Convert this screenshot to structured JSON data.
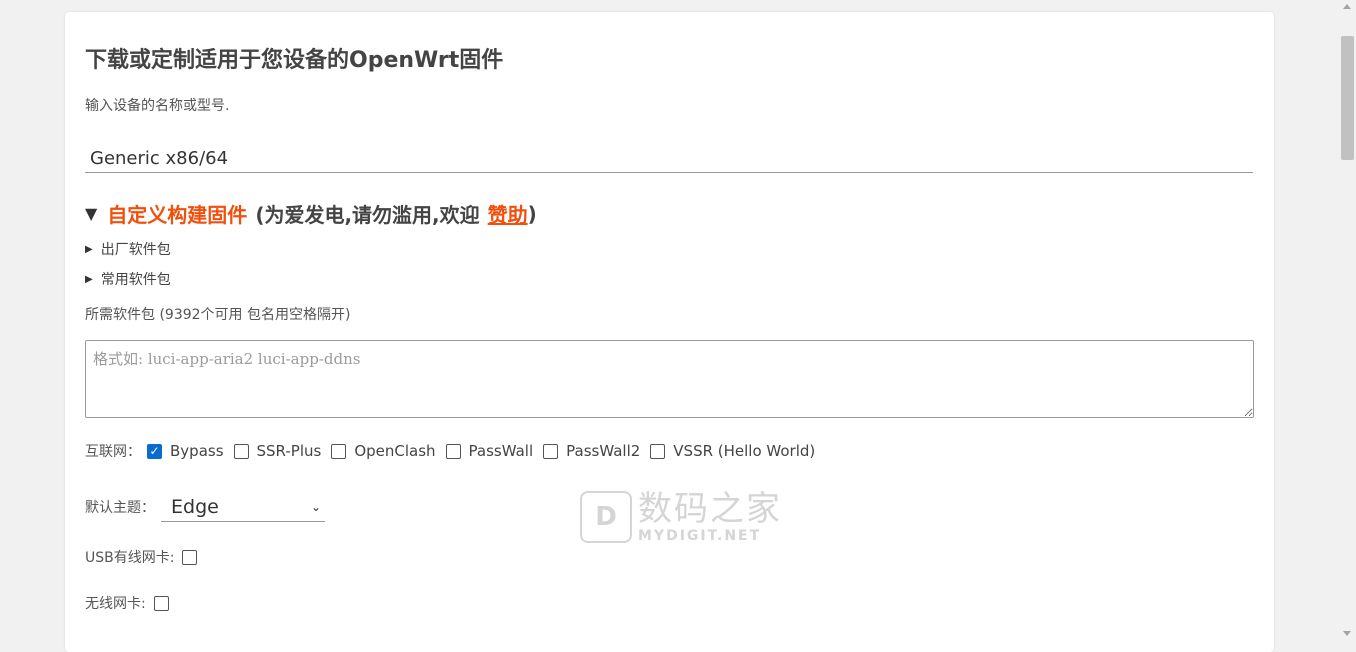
{
  "page": {
    "title": "下载或定制适用于您设备的OpenWrt固件",
    "hint": "输入设备的名称或型号.",
    "device_value": "Generic x86/64"
  },
  "custom": {
    "toggle": "▼",
    "heading": "自定义构建固件",
    "note_prefix": "(为爱发电,请勿滥用,欢迎",
    "sponsor_link": "赞助",
    "note_suffix": ")",
    "factory_packages": "出厂软件包",
    "common_packages": "常用软件包",
    "packages_label": "所需软件包 (9392个可用 包名用空格隔开)",
    "packages_placeholder": "格式如: luci-app-aria2 luci-app-ddns"
  },
  "internet": {
    "label": "互联网：",
    "options": [
      {
        "label": "Bypass",
        "checked": true
      },
      {
        "label": "SSR-Plus",
        "checked": false
      },
      {
        "label": "OpenClash",
        "checked": false
      },
      {
        "label": "PassWall",
        "checked": false
      },
      {
        "label": "PassWall2",
        "checked": false
      },
      {
        "label": "VSSR (Hello World)",
        "checked": false
      }
    ]
  },
  "theme": {
    "label": "默认主题：",
    "selected": "Edge"
  },
  "usb_nic": {
    "label": "USB有线网卡:",
    "checked": false
  },
  "wireless_nic": {
    "label": "无线网卡:",
    "checked": false
  },
  "watermark": {
    "cn": "数码之家",
    "en": "MYDIGIT.NET",
    "logo": "D"
  },
  "colors": {
    "accent": "#f34f0c",
    "checkbox": "#0b6ccf",
    "background": "#f1f1f1"
  }
}
